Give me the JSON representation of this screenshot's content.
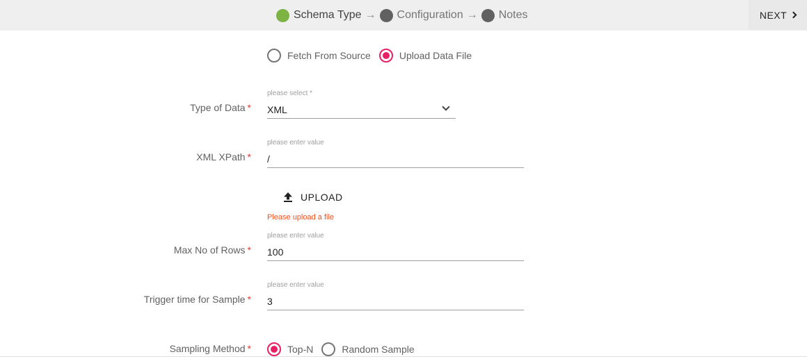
{
  "stepper": {
    "steps": [
      {
        "label": "Schema Type",
        "status": "active"
      },
      {
        "label": "Configuration",
        "status": "pending"
      },
      {
        "label": "Notes",
        "status": "pending"
      }
    ],
    "arrow": "→",
    "next_label": "NEXT",
    "active_color": "#7cb342",
    "pending_color": "#616161"
  },
  "source": {
    "options": [
      {
        "label": "Fetch From Source",
        "checked": false
      },
      {
        "label": "Upload Data File",
        "checked": true
      }
    ]
  },
  "form": {
    "required_marker": "*",
    "type_of_data": {
      "label": "Type of Data",
      "hint": "please select *",
      "value": "XML"
    },
    "xml_xpath": {
      "label": "XML XPath",
      "hint": "please enter value",
      "value": "/"
    },
    "upload": {
      "label": "UPLOAD",
      "error": "Please upload a file"
    },
    "max_rows": {
      "label": "Max No of Rows",
      "hint": "please enter value",
      "value": "100"
    },
    "trigger_time": {
      "label": "Trigger time for Sample",
      "hint": "please enter value",
      "value": "3"
    },
    "sampling_method": {
      "label": "Sampling Method",
      "options": [
        {
          "label": "Top-N",
          "checked": true
        },
        {
          "label": "Random Sample",
          "checked": false
        }
      ]
    }
  },
  "colors": {
    "accent": "#e91e63",
    "error": "#f4511e",
    "required": "#e53935"
  }
}
